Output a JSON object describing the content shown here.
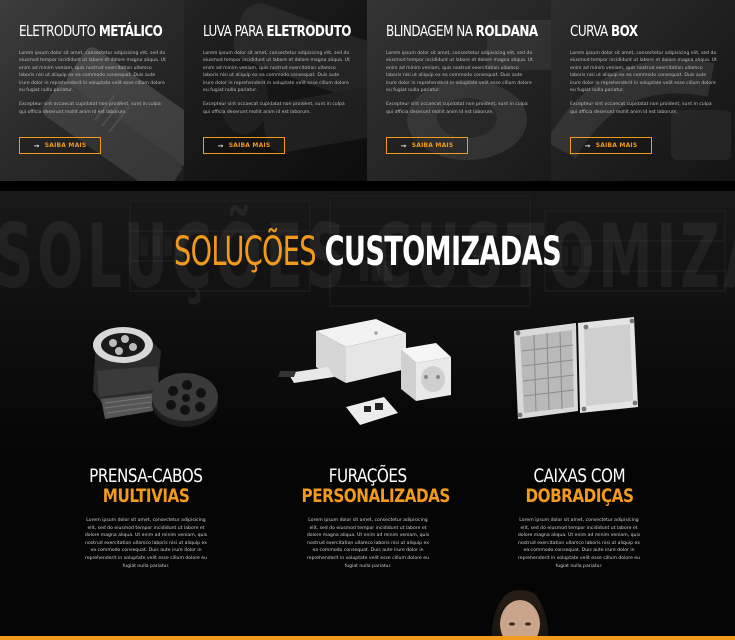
{
  "products": [
    {
      "title_light": "ELETRODUTO",
      "title_bold": "METÁLICO",
      "paragraph1": "Lorem ipsum dolor sit amet, consectetur adipisicing elit, sed do eiusmod tempor incididunt ut labore et dolore magna aliqua. Ut enim ad minim veniam, quis nostrud exercitation ullamco laboris nisi ut aliquip ex ea commodo consequat. Duis aute irure dolor in reprehenderit in voluptate velit esse cillum dolore eu fugiat nulla pariatur.",
      "paragraph2": "Excepteur sint occaecat cupidatat non proident, sunt in culpa qui officia deserunt mollit anim id est laborum.",
      "button": "SAIBA MAIS"
    },
    {
      "title_light": "LUVA PARA",
      "title_bold": "ELETRODUTO",
      "paragraph1": "Lorem ipsum dolor sit amet, consectetur adipisicing elit, sed do eiusmod tempor incididunt ut labore et dolore magna aliqua. Ut enim ad minim veniam, quis nostrud exercitation ullamco laboris nisi ut aliquip ex ea commodo consequat. Duis aute irure dolor in reprehenderit in voluptate velit esse cillum dolore eu fugiat nulla pariatur.",
      "paragraph2": "Excepteur sint occaecat cupidatat non proident, sunt in culpa qui officia deserunt mollit anim id est laborum.",
      "button": "SAIBA MAIS"
    },
    {
      "title_light": "BLINDAGEM NA",
      "title_bold": "ROLDANA",
      "paragraph1": "Lorem ipsum dolor sit amet, consectetur adipisicing elit, sed do eiusmod tempor incididunt ut labore et dolore magna aliqua. Ut enim ad minim veniam, quis nostrud exercitation ullamco laboris nisi ut aliquip ex ea commodo consequat. Duis aute irure dolor in reprehenderit in voluptate velit esse cillum dolore eu fugiat nulla pariatur.",
      "paragraph2": "Excepteur sint occaecat cupidatat non proident, sunt in culpa qui officia deserunt mollit anim id est laborum.",
      "button": "SAIBA MAIS"
    },
    {
      "title_light": "CURVA",
      "title_bold": "BOX",
      "paragraph1": "Lorem ipsum dolor sit amet, consectetur adipisicing elit, sed do eiusmod tempor incididunt ut labore et dolore magna aliqua. Ut enim ad minim veniam, quis nostrud exercitation ullamco laboris nisi ut aliquip ex ea commodo consequat. Duis aute irure dolor in reprehenderit in voluptate velit esse cillum dolore eu fugiat nulla pariatur.",
      "paragraph2": "Excepteur sint occaecat cupidatat non proident, sunt in culpa qui officia deserunt mollit anim id est laborum.",
      "button": "SAIBA MAIS"
    }
  ],
  "custom": {
    "ghost_text": "SOLUÇÕES CUSTOMIZADAS",
    "headline_light": "SOLUÇÕES",
    "headline_bold": "CUSTOMIZADAS",
    "items": [
      {
        "line1": "PRENSA-CABOS",
        "line2": "MULTIVIAS",
        "icon": "cable-gland-image",
        "text": "Lorem ipsum dolor sit amet, consectetur adipisicing elit, sed do eiusmod tempor incididunt ut labore et dolore magna aliqua. Ut enim ad minim veniam, quis nostrud exercitation ullamco laboris nisi ut aliquip ex ea commodo consequat. Duis aute irure dolor in reprehenderit in voluptate velit esse cillum dolore eu fugiat nulla pariatur."
      },
      {
        "line1": "FURAÇÕES",
        "line2": "PERSONALIZADAS",
        "icon": "custom-drilling-image",
        "text": "Lorem ipsum dolor sit amet, consectetur adipisicing elit, sed do eiusmod tempor incididunt ut labore et dolore magna aliqua. Ut enim ad minim veniam, quis nostrud exercitation ullamco laboris nisi ut aliquip ex ea commodo consequat. Duis aute irure dolor in reprehenderit in voluptate velit esse cillum dolore eu fugiat nulla pariatur."
      },
      {
        "line1": "CAIXAS COM",
        "line2": "DOBRADIÇAS",
        "icon": "hinged-box-image",
        "text": "Lorem ipsum dolor sit amet, consectetur adipisicing elit, sed do eiusmod tempor incididunt ut labore et dolore magna aliqua. Ut enim ad minim veniam, quis nostrud exercitation ullamco laboris nisi ut aliquip ex ea commodo consequat. Duis aute irure dolor in reprehenderit in voluptate velit esse cillum dolore eu fugiat nulla pariatur."
      }
    ]
  },
  "colors": {
    "accent": "#f29a1b",
    "background": "#050505",
    "card_text": "#bdbdbd"
  }
}
